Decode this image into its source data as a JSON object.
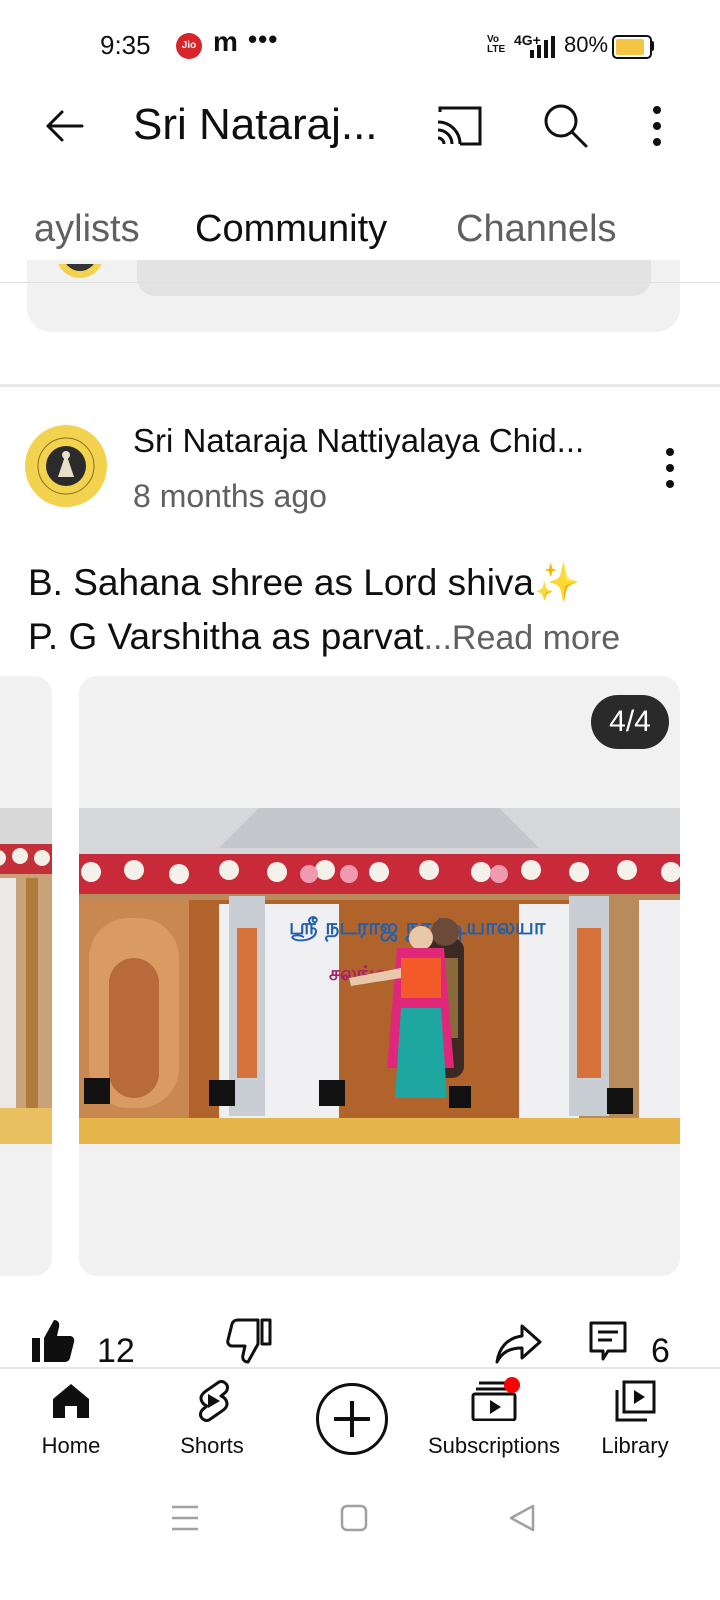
{
  "status_bar": {
    "time": "9:35",
    "carrier_badge": "Jio",
    "app_icon": "m",
    "more": "•••",
    "volte": "Vo\nLTE",
    "network": "4G+",
    "battery_percent": "80%",
    "battery_level": 0.8
  },
  "app_bar": {
    "title": "Sri Nataraj...",
    "icons": [
      "back-arrow-icon",
      "cast-icon",
      "search-icon",
      "more-vert-icon"
    ]
  },
  "tabs": [
    {
      "label": "aylists",
      "active": false
    },
    {
      "label": "Community",
      "active": true
    },
    {
      "label": "Channels",
      "active": false
    }
  ],
  "post": {
    "author": "Sri Nataraja Nattiyalaya Chid...",
    "time": "8 months ago",
    "line1": "B. Sahana shree as Lord shiva",
    "sparkle": "✨",
    "line2": "P. G Varshitha as parvat",
    "read_more": "...Read more",
    "image_counter": "4/4",
    "banner_text_1": "ஸ்ரீ நடராஜ நாட்டியாலயா",
    "banner_text_2": "சலங்கை விழா",
    "likes": "12",
    "comments": "6"
  },
  "bottom_nav": [
    {
      "label": "Home",
      "icon": "home-icon",
      "active": true
    },
    {
      "label": "Shorts",
      "icon": "shorts-icon",
      "active": false
    },
    {
      "label": "",
      "icon": "create-icon",
      "active": false
    },
    {
      "label": "Subscriptions",
      "icon": "subscriptions-icon",
      "active": false
    },
    {
      "label": "Library",
      "icon": "library-icon",
      "active": false
    }
  ],
  "colors": {
    "text_primary": "#0f0f0f",
    "text_secondary": "#606060",
    "card_bg": "#f1f1f1",
    "notification_dot": "#ff0000",
    "avatar_bg": "#f2d24e"
  }
}
